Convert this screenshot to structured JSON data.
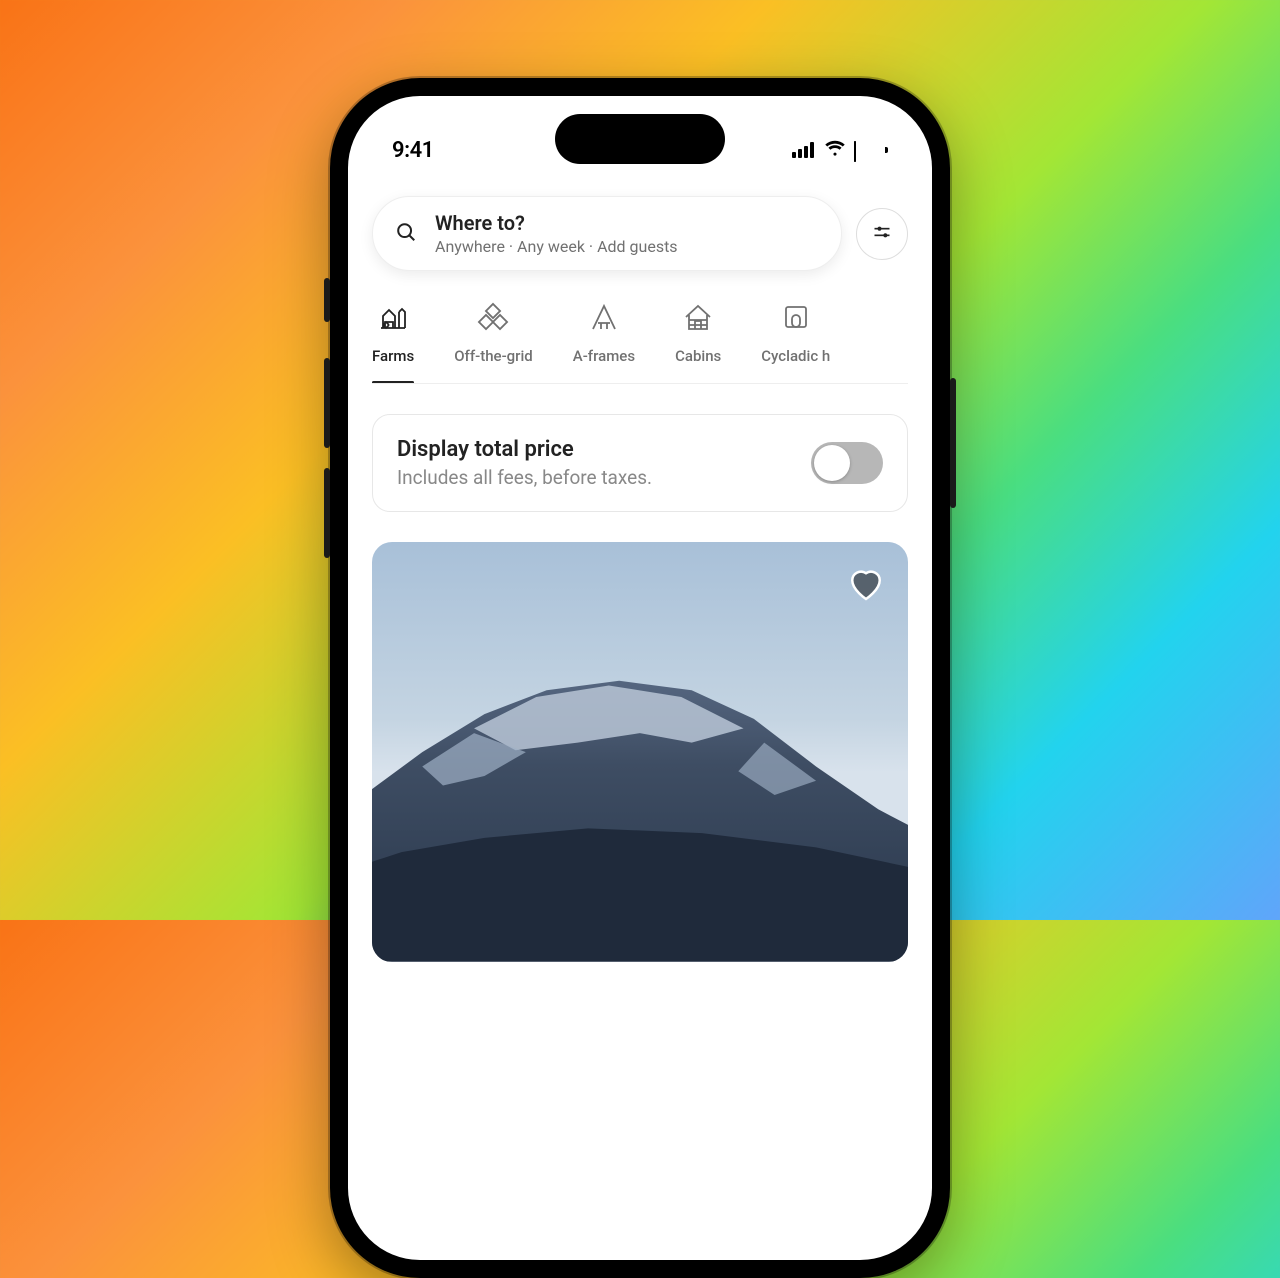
{
  "status": {
    "time": "9:41"
  },
  "search": {
    "title": "Where to?",
    "subtitle": "Anywhere · Any week · Add guests"
  },
  "categories": [
    {
      "label": "Farms",
      "icon": "farm",
      "active": true
    },
    {
      "label": "Off-the-grid",
      "icon": "grid",
      "active": false
    },
    {
      "label": "A-frames",
      "icon": "aframe",
      "active": false
    },
    {
      "label": "Cabins",
      "icon": "cabin",
      "active": false
    },
    {
      "label": "Cycladic h",
      "icon": "cycladic",
      "active": false
    }
  ],
  "price_toggle": {
    "title": "Display total price",
    "subtitle": "Includes all fees, before taxes.",
    "enabled": false
  }
}
